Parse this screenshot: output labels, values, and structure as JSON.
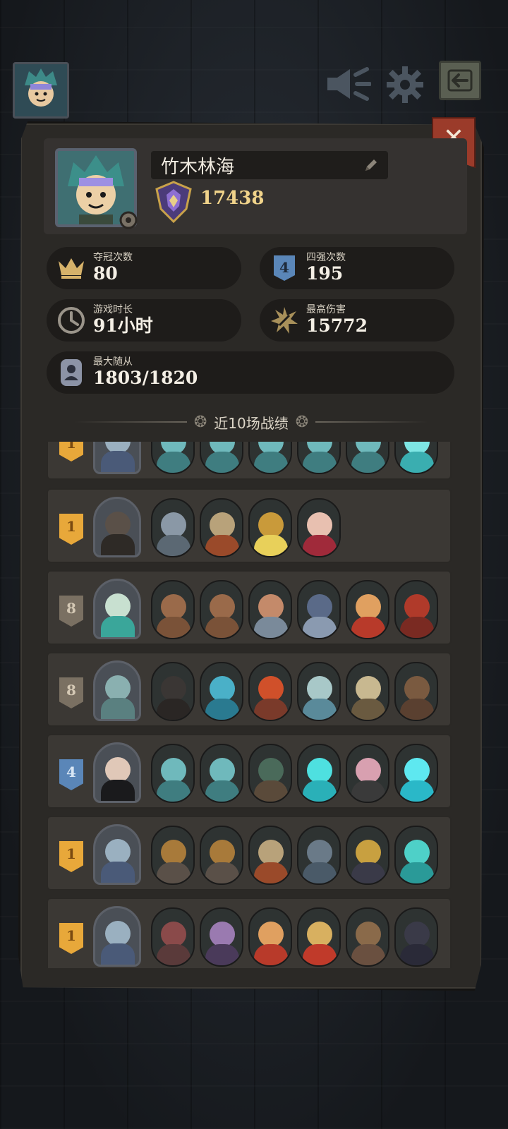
{
  "player": {
    "name": "竹木林海",
    "rank_score": "17438"
  },
  "stats": {
    "championships": {
      "label": "夺冠次数",
      "value": "80"
    },
    "top4": {
      "label": "四强次数",
      "value": "195",
      "icon_text": "4"
    },
    "playtime": {
      "label": "游戏时长",
      "value": "91小时"
    },
    "max_damage": {
      "label": "最高伤害",
      "value": "15772"
    },
    "max_followers": {
      "label": "最大随从",
      "value": "1803/1820"
    }
  },
  "section": {
    "title": "近10场战绩"
  },
  "icons": {
    "top_avatar": "player-avatar-icon",
    "speaker": "speaker-icon",
    "settings": "gear-icon",
    "exit": "exit-arrow-icon",
    "close": "close-icon"
  },
  "colors": {
    "panel": "#2b2926",
    "gold": "#f0d38a",
    "close_red": "#9b3b2a",
    "place_gold": "#e8a83a",
    "place_blue": "#5a86b8",
    "place_gray": "#7a7062"
  },
  "matches": [
    {
      "place": "1",
      "tier": "gold",
      "hero": "goblin-top-hat",
      "minions": [
        "ghost",
        "ghost",
        "ghost",
        "ghost",
        "ghost",
        "ghost-knight"
      ]
    },
    {
      "place": "1",
      "tier": "gold",
      "hero": "cat-rogue",
      "minions": [
        "ufo-machine",
        "missile",
        "robot-miner",
        "clown"
      ]
    },
    {
      "place": "8",
      "tier": "gray",
      "hero": "fairy-queen",
      "minions": [
        "treant",
        "treant",
        "dwarf-warrior",
        "armored-knight",
        "red-hair-warrior",
        "red-helmet-knight"
      ]
    },
    {
      "place": "8",
      "tier": "gray",
      "hero": "zombie-brute",
      "minions": [
        "spider",
        "rabbit-monster",
        "scorpion",
        "bat-beast",
        "skeleton-dog",
        "voodoo-doll"
      ]
    },
    {
      "place": "4",
      "tier": "blue",
      "hero": "hooded-assassin",
      "minions": [
        "ghost",
        "ghost",
        "grim-reaper",
        "ghost-knight",
        "rat-gentleman",
        "ghost-spirit"
      ]
    },
    {
      "place": "1",
      "tier": "gold",
      "hero": "goblin-top-hat",
      "minions": [
        "beetle-tank",
        "beetle-tank",
        "missile",
        "shark-warrior",
        "golden-bat",
        "ghost-samurai"
      ]
    },
    {
      "place": "1",
      "tier": "gold",
      "hero": "goblin-top-hat",
      "minions": [
        "mimic-chest",
        "dark-elf",
        "red-hair-warrior",
        "pinocchio",
        "explorer",
        "black-panther"
      ]
    }
  ]
}
